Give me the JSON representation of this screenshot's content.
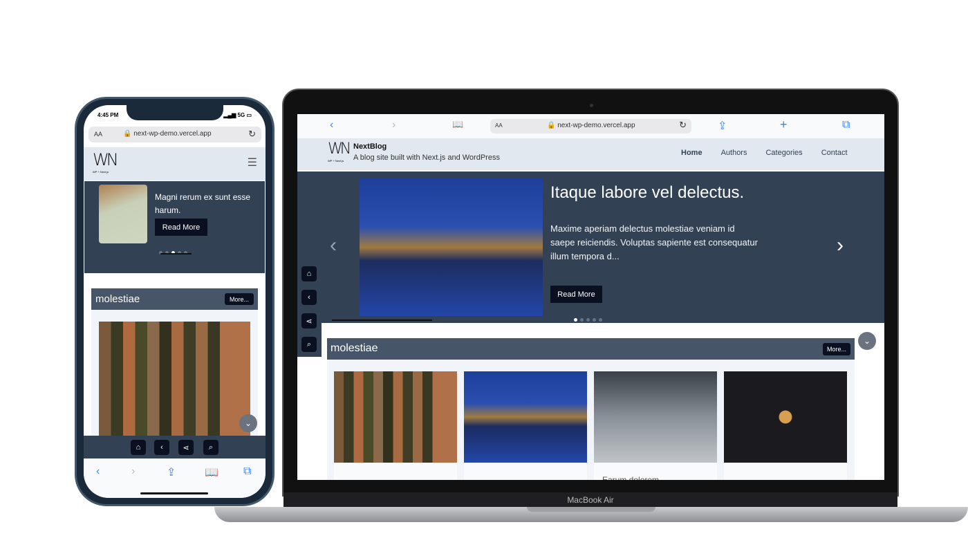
{
  "colors": {
    "header_bg": "#e2e8f0",
    "hero_bg": "#334155",
    "category_header_bg": "#475569",
    "button_bg": "#0b1020",
    "safari_blue": "#3b82f6"
  },
  "phone": {
    "status_time": "4:45 PM",
    "status_network": "5G",
    "url_aa": "AA",
    "url": "next-wp-demo.vercel.app",
    "logo_sub": "WP + Next.js",
    "logo": "WN",
    "hero_title": "Magni rerum ex sunt esse harum.",
    "hero_button": "Read More",
    "category_title": "molestiae",
    "more_button": "More...",
    "bottom_icons": [
      "home-icon",
      "back-icon",
      "share-icon",
      "search-icon"
    ],
    "safari_icons": [
      "back-icon",
      "forward-icon",
      "share-icon",
      "bookmarks-icon",
      "tabs-icon"
    ]
  },
  "laptop": {
    "url_aa": "AA",
    "url": "next-wp-demo.vercel.app",
    "site_name": "NextBlog",
    "site_tagline": "A blog site built with Next.js and WordPress",
    "logo": "WN",
    "logo_sub": "WP + Next.js",
    "nav": [
      "Home",
      "Authors",
      "Categories",
      "Contact"
    ],
    "hero_title": "Itaque labore vel delectus.",
    "hero_excerpt": "Maxime aperiam delectus molestiae veniam id saepe reiciendis. Voluptas sapiente est consequatur illum tempora d...",
    "hero_button": "Read More",
    "slide_active": 1,
    "slide_count": 5,
    "category_title": "molestiae",
    "more_button": "More...",
    "cards": [
      {
        "title": ""
      },
      {
        "title": ""
      },
      {
        "title": "Earum dolorem"
      },
      {
        "title": ""
      }
    ],
    "device_label": "MacBook Air"
  }
}
